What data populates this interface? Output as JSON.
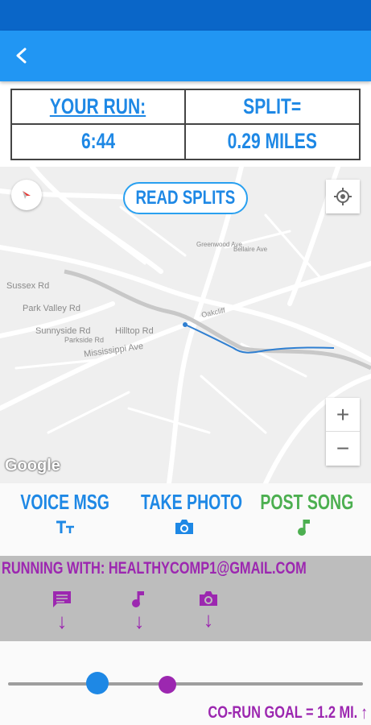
{
  "app_bar": {
    "back_icon": "chevron-left-icon"
  },
  "stats": {
    "your_run_label": "YOUR RUN:",
    "split_label": "SPLIT=",
    "your_run_value": "6:44",
    "split_value": "0.29 MILES"
  },
  "map": {
    "read_splits_label": "READ SPLITS",
    "compass_icon": "compass-icon",
    "locate_icon": "my-location-icon",
    "zoom_in_label": "+",
    "zoom_out_label": "−",
    "attribution": "Google",
    "labels": {
      "sussex": "Sussex Rd",
      "park_valley": "Park Valley Rd",
      "sunnyside": "Sunnyside Rd",
      "hilltop": "Hilltop Rd",
      "mississippi": "Mississippi Ave",
      "parkside": "Parkside Rd",
      "oakcliff": "Oakcliff",
      "greenwood": "Greenwood Ave",
      "bellaire": "Bellaire Ave"
    }
  },
  "actions": {
    "voice_msg": {
      "label": "VOICE MSG",
      "icon": "text-size-icon",
      "color": "#1e88e5"
    },
    "take_photo": {
      "label": "TAKE PHOTO",
      "icon": "camera-icon",
      "color": "#1e88e5"
    },
    "post_song": {
      "label": "POST SONG",
      "icon": "music-note-icon",
      "color": "#4caf50"
    }
  },
  "co_run": {
    "running_with": "RUNNING WITH: HEALTHYCOMP1@GMAIL.COM",
    "items": [
      {
        "icon": "message-icon",
        "arrow": "↓"
      },
      {
        "icon": "music-note-icon",
        "arrow": "↓"
      },
      {
        "icon": "camera-icon",
        "arrow": "↓"
      }
    ],
    "accent": "#9c27b0"
  },
  "slider": {
    "goal_label": "CO-RUN GOAL = 1.2 MI.",
    "goal_arrow": "↑",
    "runner_progress_fraction": 0.23,
    "corunner_progress_fraction": 0.45
  },
  "colors": {
    "status_bar": "#0a66c8",
    "app_bar": "#2196f3",
    "primary": "#1e88e5",
    "song": "#4caf50",
    "co_run": "#9c27b0"
  }
}
